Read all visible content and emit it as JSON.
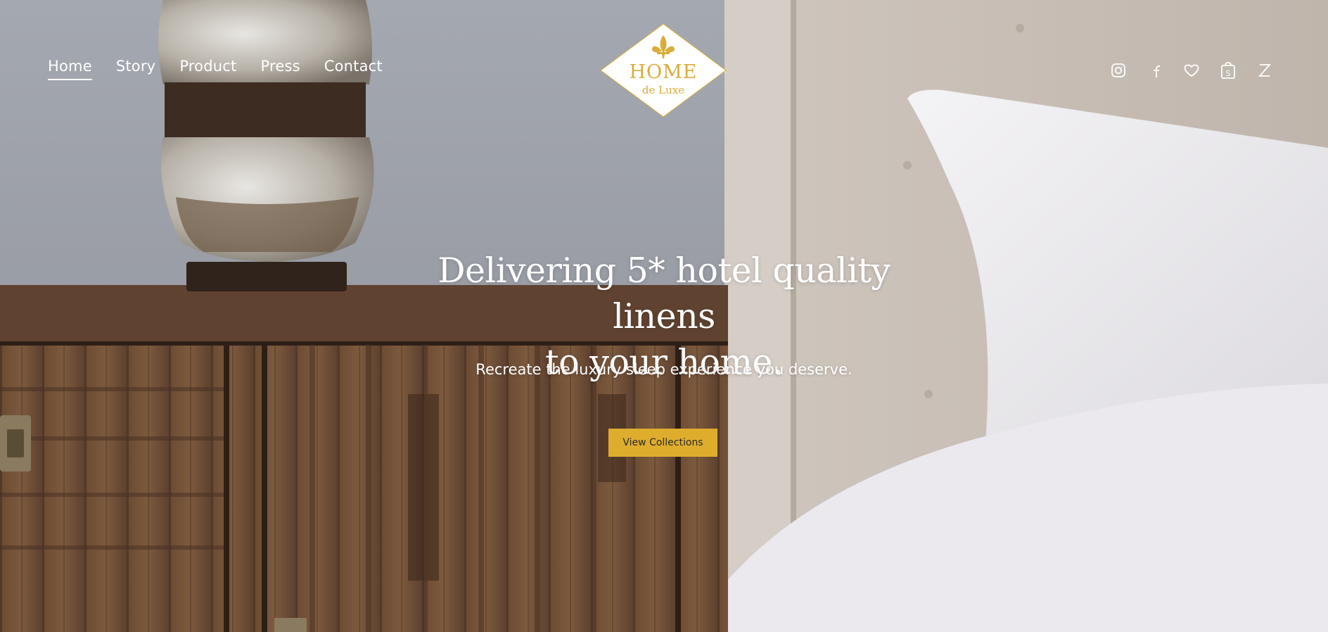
{
  "nav": {
    "items": [
      {
        "label": "Home",
        "active": true
      },
      {
        "label": "Story",
        "active": false
      },
      {
        "label": "Product",
        "active": false
      },
      {
        "label": "Press",
        "active": false
      },
      {
        "label": "Contact",
        "active": false
      }
    ]
  },
  "logo": {
    "main": "HOME",
    "sub": "de Luxe",
    "color": "#d9ad3a"
  },
  "header_icons": [
    "instagram-icon",
    "facebook-icon",
    "heart-icon",
    "shopping-bag-icon",
    "z-icon"
  ],
  "hero": {
    "headline_line1": "Delivering 5* hotel quality linens",
    "headline_line2": "to your home.",
    "subheadline": "Recreate the luxury sleep experience you deserve.",
    "cta_label": "View Collections",
    "cta_color": "#dfad2d"
  },
  "cart_icon_glyph": "S",
  "z_icon_glyph": "Z"
}
